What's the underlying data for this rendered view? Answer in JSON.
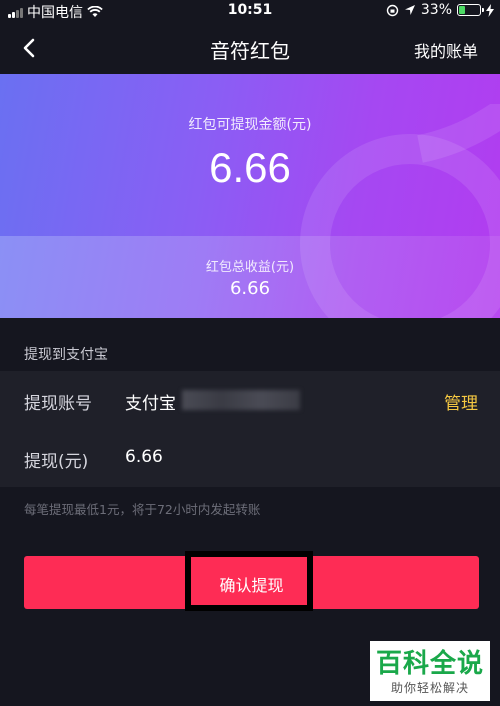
{
  "status_bar": {
    "carrier": "中国电信",
    "time": "10:51",
    "battery_percent": "33%",
    "battery_level": 0.33
  },
  "nav": {
    "title": "音符红包",
    "account_link": "我的账单"
  },
  "hero": {
    "withdrawable_label": "红包可提现金额(元)",
    "withdrawable_amount": "6.66",
    "total_label": "红包总收益(元)",
    "total_amount": "6.66"
  },
  "withdraw": {
    "section_title": "提现到支付宝",
    "account_label": "提现账号",
    "account_value": "支付宝",
    "manage_label": "管理",
    "amount_label": "提现(元)",
    "amount_value": "6.66",
    "note": "每笔提现最低1元，将于72小时内发起转账",
    "confirm_label": "确认提现"
  },
  "watermark": {
    "title": "百科全说",
    "subtitle": "助你轻松解决"
  },
  "colors": {
    "accent": "#fe2c55",
    "manage": "#f5c842",
    "background": "#15161f"
  }
}
